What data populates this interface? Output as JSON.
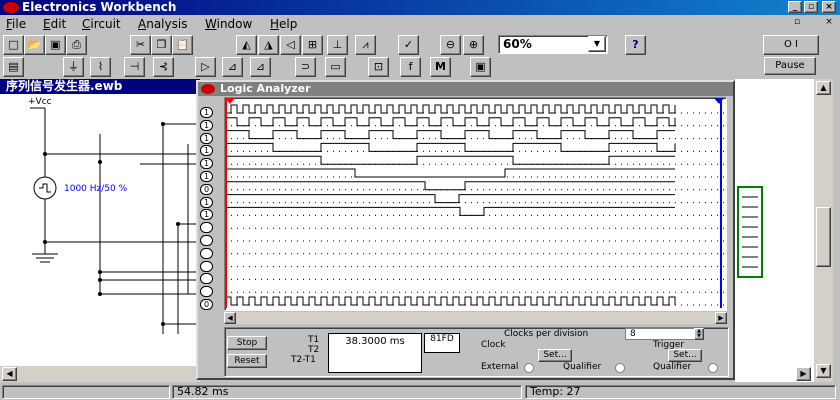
{
  "app": {
    "title": "Electronics Workbench"
  },
  "menu": [
    "File",
    "Edit",
    "Circuit",
    "Analysis",
    "Window",
    "Help"
  ],
  "menu_hotkeys": [
    "F",
    "E",
    "C",
    "A",
    "W",
    "H"
  ],
  "toolbar": {
    "zoom_value": "60%",
    "help_label": "?",
    "pause_label": "Pause",
    "power_label": "O  I",
    "m_label": "M",
    "f_label": "f"
  },
  "circuit_window": {
    "title": "序列信号发生器.ewb",
    "vcc_label": "+Vcc",
    "source_label": "1000  Hz/50 %"
  },
  "logic_analyzer": {
    "title": "Logic Analyzer",
    "channels": [
      "1",
      "1",
      "1",
      "1",
      "1",
      "1",
      "0",
      "1",
      "1",
      "",
      "",
      "",
      "",
      "",
      "",
      "0"
    ],
    "stop_label": "Stop",
    "reset_label": "Reset",
    "t1_label": "T1",
    "t2_label": "T2",
    "t2t1_label": "T2-T1",
    "time_value": "38.3000 ms",
    "hex_value": "81FD",
    "clocks_per_division_label": "Clocks per division",
    "clocks_per_division_value": "8",
    "clock_label": "Clock",
    "trigger_label": "Trigger",
    "set_label": "Set...",
    "external_label": "External",
    "qualifier_label": "Qualifier"
  },
  "statusbar": {
    "time": "54.82 ms",
    "temp": "Temp:  27"
  },
  "colors": {
    "title_active": "#000080",
    "title_inactive": "#808080",
    "cursor1": "#ff0000",
    "cursor2": "#0000ff",
    "wire": "#000000",
    "source": "#0000ff"
  }
}
